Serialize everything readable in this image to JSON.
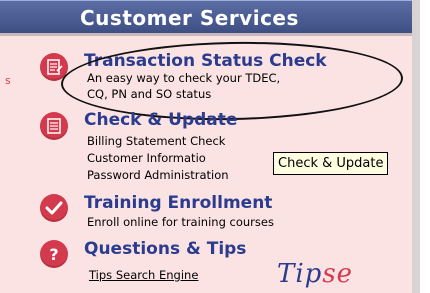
{
  "header": {
    "title": "Customer Services"
  },
  "left_fragment": "s",
  "sections": [
    {
      "title": "Transaction Status Check",
      "lines": [
        "An easy way to check your TDEC,",
        "CQ, PN and SO status"
      ]
    },
    {
      "title": "Check & Update",
      "lines": [
        "Billing Statement Check",
        "Customer Informatio",
        "Password Administration"
      ]
    },
    {
      "title": "Training Enrollment",
      "lines": [
        "Enroll online for training courses"
      ]
    },
    {
      "title": "Questions & Tips",
      "lines": [
        "Tips Search Engine"
      ]
    }
  ],
  "tooltip": {
    "text": "Check & Update"
  },
  "tipse_logo": {
    "main": "Tip",
    "accent": "se"
  },
  "colors": {
    "header_bg": "#4c5e97",
    "panel_bg": "#fbe3e3",
    "title": "#2b3c8f",
    "icon": "#d43a4d"
  },
  "icons": [
    "edit-list-icon",
    "list-icon",
    "check-icon",
    "question-icon"
  ]
}
